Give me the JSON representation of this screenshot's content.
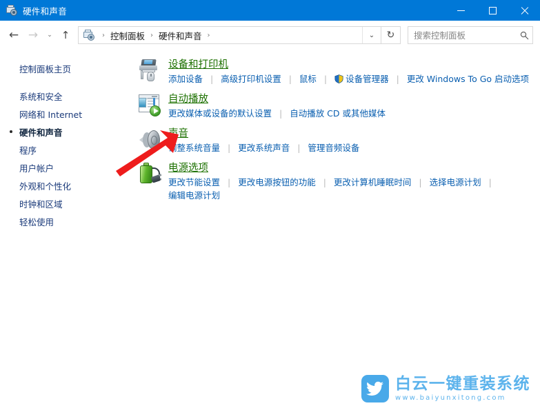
{
  "window": {
    "title": "硬件和声音",
    "title_icon": "hardware-and-sound-icon",
    "minimize_label": "",
    "maximize_label": "",
    "close_label": ""
  },
  "nav": {
    "back_icon": "←",
    "forward_icon": "→",
    "recent_icon": "⌄",
    "up_icon": "↑",
    "refresh_icon": "↻",
    "dropdown_icon": "⌄",
    "breadcrumb": [
      "控制面板",
      "硬件和声音"
    ],
    "breadcrumb_sep": "›"
  },
  "search": {
    "placeholder": "搜索控制面板",
    "value": "",
    "icon": "search-icon"
  },
  "sidebar": {
    "home": "控制面板主页",
    "items": [
      {
        "label": "系统和安全",
        "selected": false
      },
      {
        "label": "网络和 Internet",
        "selected": false
      },
      {
        "label": "硬件和声音",
        "selected": true
      },
      {
        "label": "程序",
        "selected": false
      },
      {
        "label": "用户帐户",
        "selected": false
      },
      {
        "label": "外观和个性化",
        "selected": false
      },
      {
        "label": "时钟和区域",
        "selected": false
      },
      {
        "label": "轻松使用",
        "selected": false
      }
    ]
  },
  "categories": [
    {
      "icon": "devices-and-printers-icon",
      "title": "设备和打印机",
      "links": [
        {
          "label": "添加设备",
          "shield": false
        },
        {
          "label": "高级打印机设置",
          "shield": false
        },
        {
          "label": "鼠标",
          "shield": false
        },
        {
          "label": "设备管理器",
          "shield": true
        },
        {
          "label": "更改 Windows To Go 启动选项",
          "shield": false
        }
      ]
    },
    {
      "icon": "autoplay-icon",
      "title": "自动播放",
      "links": [
        {
          "label": "更改媒体或设备的默认设置",
          "shield": false
        },
        {
          "label": "自动播放 CD 或其他媒体",
          "shield": false
        }
      ]
    },
    {
      "icon": "sound-icon",
      "title": "声音",
      "links": [
        {
          "label": "调整系统音量",
          "shield": false
        },
        {
          "label": "更改系统声音",
          "shield": false
        },
        {
          "label": "管理音频设备",
          "shield": false
        }
      ]
    },
    {
      "icon": "power-options-icon",
      "title": "电源选项",
      "links": [
        {
          "label": "更改节能设置",
          "shield": false
        },
        {
          "label": "更改电源按钮的功能",
          "shield": false
        },
        {
          "label": "更改计算机睡眠时间",
          "shield": false
        },
        {
          "label": "选择电源计划",
          "shield": false
        },
        {
          "label": "编辑电源计划",
          "shield": false
        }
      ]
    }
  ],
  "annotation": {
    "type": "red-arrow",
    "color": "#ee1c1c",
    "points_at": "声音"
  },
  "watermark": {
    "name": "白云一键重装系统",
    "url": "www.baiyunxitong.com",
    "logo_icon": "bird-logo-icon",
    "color": "#5cb3ec",
    "logo_bg": "#49a9e9"
  },
  "colors": {
    "titlebar": "#0078d7",
    "category_title": "#1c7000",
    "link": "#0a5fb0",
    "sidebar_link": "#1a3a7a"
  }
}
